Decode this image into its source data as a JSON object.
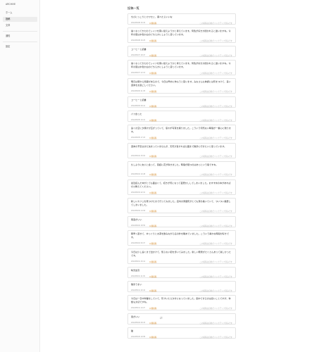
{
  "app": {
    "brand": "ARCHIVE"
  },
  "sidebar": {
    "items": [
      {
        "label": "ホーム"
      },
      {
        "label": "投稿"
      },
      {
        "label": "文章"
      },
      {
        "label": "通知"
      },
      {
        "label": "設定"
      }
    ]
  },
  "page": {
    "title": "投稿一覧"
  },
  "posts": [
    {
      "text": "ちびにっこりとカワセミ、飛べたらいいな",
      "date": "2024/06/08 16:33",
      "tag": "公開投稿",
      "note": "この投稿は自動でバックアップ済みです"
    },
    {
      "text": "暑くなってきたのでシャツを買い替えようかと考えています。何色が好きか聞かれると迷いますね。今年の夏は水色か白のどちらかにしようと思っています。",
      "date": "2024/06/08 16:25",
      "tag": "公開投稿",
      "note": "この投稿は自動でバックアップ済みです"
    },
    {
      "text": "コーヒーと読書",
      "date": "2024/06/07 18:47",
      "tag": "公開投稿",
      "note": "この投稿は自動でバックアップ済みです"
    },
    {
      "text": "暑くなってきたのでシャツを買い替えようかと考えています。何色が好きか聞かれると迷いますね。今年の夏は水色か白のどちらかにしようと思っています。",
      "date": "2024/06/07 12:10",
      "tag": "公開投稿",
      "note": "この投稿は自動でバックアップ済みです"
    },
    {
      "text": "明日は朝から用事があるので、今日は早めに休もうと思います。みなさんも体調には気をつけて、良い週末をお過ごしください。",
      "date": "2024/06/06 21:05",
      "tag": "公開投稿",
      "note": "この投稿は自動でバックアップ済みです"
    },
    {
      "text": "コーヒーと読書",
      "date": "2024/06/06 09:14",
      "tag": "公開投稿",
      "note": "この投稿は自動でバックアップ済みです"
    },
    {
      "text": "パフ食った",
      "date": "2024/06/05 19:41",
      "tag": "公開投稿",
      "note": "この投稿は自動でバックアップ済みです"
    },
    {
      "text": "遠くの空に夕焼けが広がっていて、思わず写真を撮りました。こういう何気ない瞬間が一番心に残ります。",
      "date": "2024/06/05 17:20",
      "tag": "公開投稿",
      "note": "この投稿は自動でバックアップ済みです"
    },
    {
      "text": "週末の予定はまだ決まっていませんが、天気が良ければ公園まで散歩に行きたいと思っています。",
      "date": "2024/06/04 15:02",
      "tag": "公開投稿",
      "note": "この投稿は自動でバックアップ済みです"
    },
    {
      "text": "久しぶりに友人と会って、昔話に花が咲きました。時間が経つのはあっという間ですね。",
      "date": "2024/06/04 10:48",
      "tag": "公開投稿",
      "note": "この投稿は自動でバックアップ済みです"
    },
    {
      "text": "最近読んだ本がとても面白くて、続きが気になって夜更かししてしまいました。おすすめの本があればぜひ教えてください。",
      "date": "2024/06/03 22:31",
      "tag": "公開投稿",
      "note": "この投稿は自動でバックアップ済みです"
    },
    {
      "text": "新しいカフェを見つけたので行ってみました。店内の雰囲気がとても落ち着いていて、ついつい長居してしまいました。",
      "date": "2024/06/03 14:09",
      "tag": "公開投稿",
      "note": "この投稿は自動でバックアップ済みです"
    },
    {
      "text": "雨音がいい",
      "date": "2024/06/02 18:56",
      "tag": "公開投稿",
      "note": "この投稿は自動でバックアップ済みです"
    },
    {
      "text": "朝早く起きて、ゆっくりとお茶を飲みながら窓の外を眺めていました。こういう静かな時間が好きです。",
      "date": "2024/06/02 06:37",
      "tag": "公開投稿",
      "note": "この投稿は自動でバックアップ済みです"
    },
    {
      "text": "今日は少し遠くまで出かけて、知らない街を歩いてみました。新しい発見がたくさんあって楽しかったです。",
      "date": "2024/06/01 16:12",
      "tag": "公開投稿",
      "note": "この投稿は自動でバックアップ済みです"
    },
    {
      "text": "晴天最高",
      "date": "2024/06/01 11:03",
      "tag": "公開投稿",
      "note": "この投稿は自動でバックアップ済みです"
    },
    {
      "text": "散歩うまい",
      "date": "2024/05/31 20:44",
      "tag": "公開投稿",
      "note": "この投稿は自動でバックアップ済みです"
    },
    {
      "text": "今日は一日中作業をしていて、気づいたら夕方になっていました。集中できるのは良いことですが、休憩も大切ですね。",
      "date": "2024/05/31 13:27",
      "tag": "公開投稿",
      "note": "この投稿は自動でバックアップ済みです"
    },
    {
      "text": "風がいい",
      "date": "2024/05/30 09:15",
      "tag": "公開投稿",
      "note": "この投稿は自動でバックアップ済みです"
    },
    {
      "text": "猫",
      "date": "2024/05/29 19:58",
      "tag": "公開投稿",
      "note": "この投稿は自動でバックアップ済みです"
    }
  ]
}
